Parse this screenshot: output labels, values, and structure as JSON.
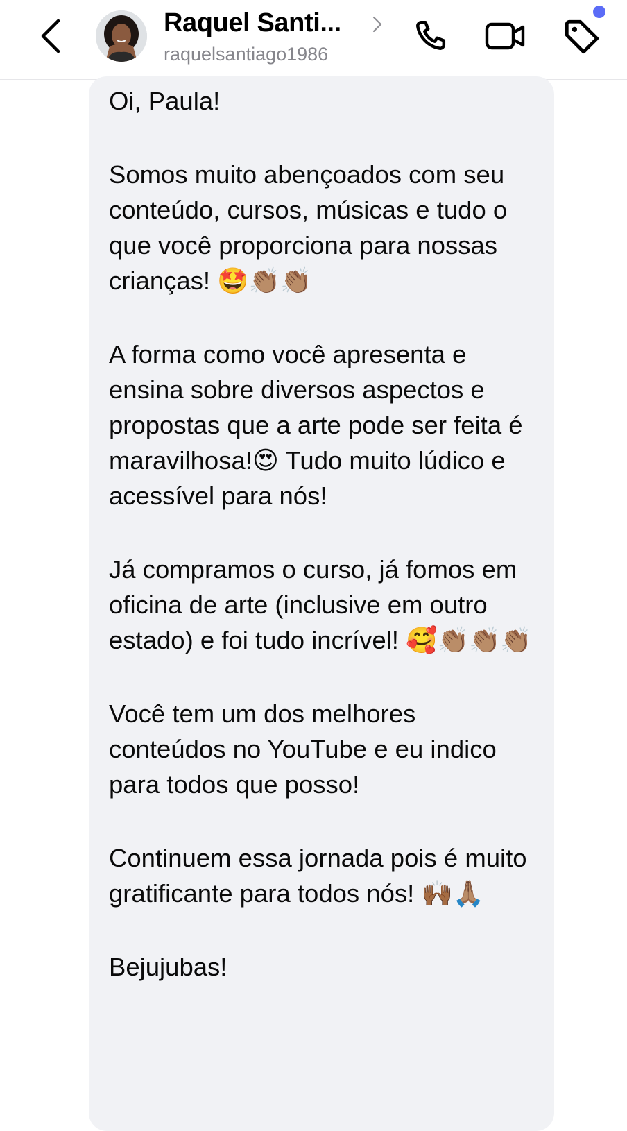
{
  "header": {
    "contact_name": "Raquel Santi...",
    "username": "raquelsantiago1986",
    "icons": [
      "back-icon",
      "chevron-right-icon",
      "phone-icon",
      "video-icon",
      "tag-icon"
    ],
    "accent_color": "#5b6cf7"
  },
  "message": {
    "paragraphs": [
      "Oi, Paula!",
      "Somos muito abençoados com seu conteúdo, cursos, músicas e tudo o que você proporciona para nossas crianças! 🤩👏🏽👏🏽",
      "A forma como você apresenta e ensina sobre diversos aspectos e propostas que a arte pode ser feita é maravilhosa!😍 Tudo muito lúdico e acessível para nós!",
      "Já compramos o curso, já fomos em oficina de arte (inclusive em outro estado) e foi tudo incrível! 🥰👏🏽👏🏽👏🏽",
      "Você tem um dos melhores conteúdos no YouTube e eu indico para todos que posso!",
      "Continuem essa jornada pois é muito gratificante para todos nós! 🙌🏾🙏🏽",
      "Bejujubas!"
    ]
  }
}
